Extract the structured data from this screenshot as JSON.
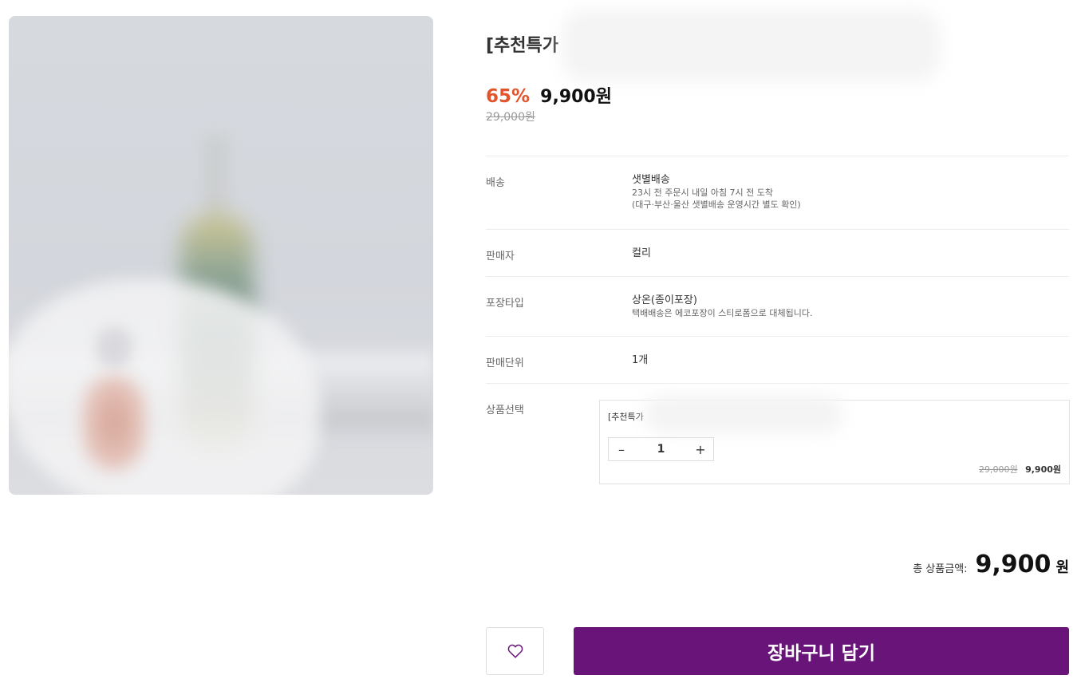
{
  "product": {
    "title": "[추천특가",
    "discount": "65%",
    "price": "9,900원",
    "original_price": "29,000원"
  },
  "info": {
    "delivery": {
      "label": "배송",
      "value": "샛별배송",
      "sub1": "23시 전 주문시 내일 아침 7시 전 도착",
      "sub2": "(대구·부산·울산 샛별배송 운영시간 별도 확인)"
    },
    "seller": {
      "label": "판매자",
      "value": "컬리"
    },
    "package": {
      "label": "포장타입",
      "value": "상온(종이포장)",
      "sub1": "택배배송은 에코포장이 스티로폼으로 대체됩니다."
    },
    "unit": {
      "label": "판매단위",
      "value": "1개"
    },
    "select": {
      "label": "상품선택"
    }
  },
  "option": {
    "name": "[추천특가",
    "minus": "–",
    "quantity": "1",
    "plus": "+",
    "original_price": "29,000원",
    "price": "9,900원"
  },
  "total": {
    "label": "총 상품금액:",
    "amount": "9,900",
    "unit": "원"
  },
  "actions": {
    "wish_icon": "heart-icon",
    "cart_label": "장바구니 담기"
  },
  "colors": {
    "brand": "#681478",
    "discount": "#e2542b"
  }
}
